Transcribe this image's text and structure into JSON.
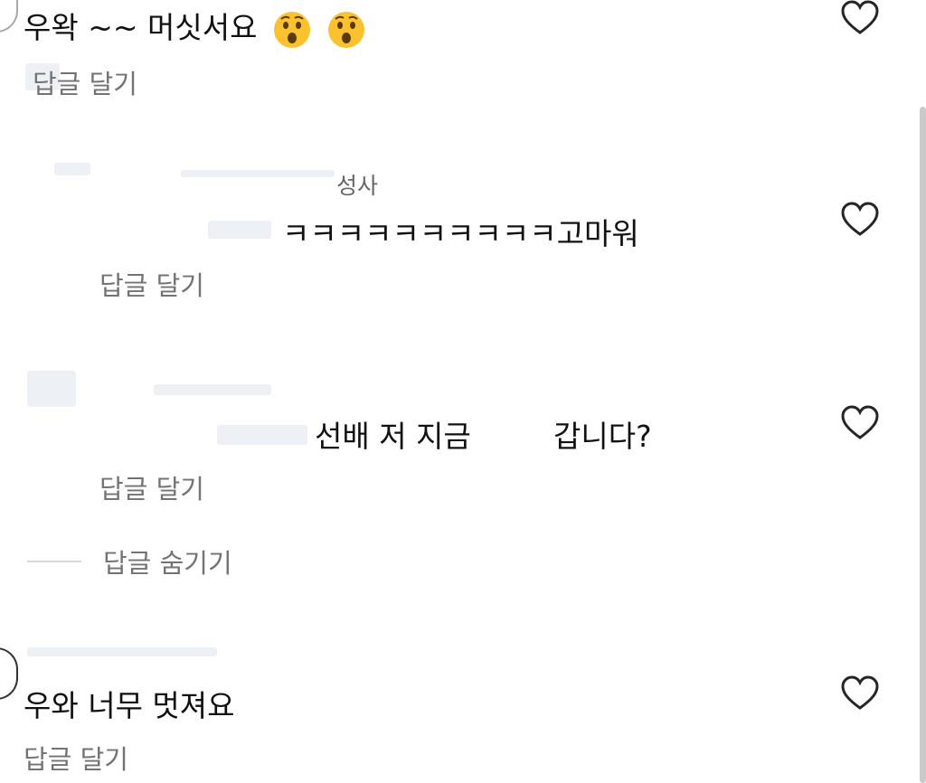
{
  "comments": [
    {
      "text": "우왁 ~~ 머싯서요",
      "reply": "답글 달기"
    },
    {
      "username": "성사",
      "text": "ㅋㅋㅋㅋㅋㅋㅋㅋㅋㅋ고마워",
      "reply": "답글 달기"
    },
    {
      "text_a": "선배 저 지금",
      "text_b": "갑니다?",
      "reply": "답글 달기",
      "hide_replies": "답글 숨기기"
    },
    {
      "text": "우와 너무 멋져요",
      "reply": "답글 달기"
    }
  ],
  "icons": {
    "like": "heart-outline-icon",
    "emoji": "astonished-face-icon"
  },
  "colors": {
    "text": "#111111",
    "secondary": "#737373",
    "heart_stroke": "#262626"
  }
}
